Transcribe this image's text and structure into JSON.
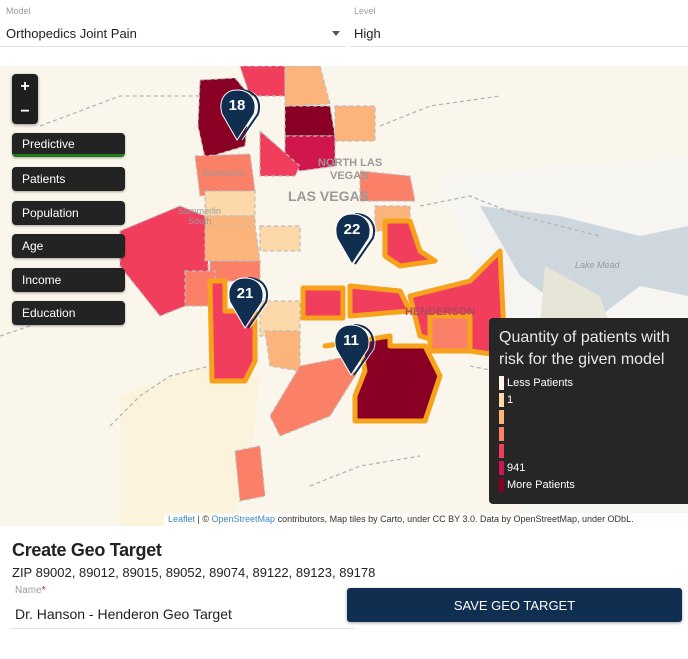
{
  "filters": {
    "model_label": "Model",
    "model_value": "Orthopedics Joint  Pain",
    "level_label": "Level",
    "level_value": "High"
  },
  "map": {
    "zoom_in": "+",
    "zoom_out": "−",
    "layers": [
      {
        "label": "Predictive",
        "active": true
      },
      {
        "label": "Patients",
        "active": false
      },
      {
        "label": "Population",
        "active": false
      },
      {
        "label": "Age",
        "active": false
      },
      {
        "label": "Income",
        "active": false
      },
      {
        "label": "Education",
        "active": false
      }
    ],
    "place_labels": [
      "NORTH LAS VEGAS",
      "LAS VEGAS",
      "Summerlin",
      "Summerlin South",
      "HENDERSON",
      "Lake Mead",
      "Spring Valley"
    ],
    "clusters": [
      {
        "count": "18"
      },
      {
        "count": "22"
      },
      {
        "count": "21"
      },
      {
        "count": "11"
      }
    ],
    "marker_color": "#0f2e50",
    "selected_outline_color": "#f7a21b",
    "legend": {
      "title": "Quantity of patients with risk for the given model",
      "items": [
        {
          "label": "Less Patients",
          "color": "#fff5e8"
        },
        {
          "label": "1",
          "color": "#fdd9a9"
        },
        {
          "label": "",
          "color": "#fdb47a"
        },
        {
          "label": "",
          "color": "#fb8068"
        },
        {
          "label": "",
          "color": "#f03e5c"
        },
        {
          "label": "941",
          "color": "#d0164a"
        },
        {
          "label": "More Patients",
          "color": "#8a0025"
        }
      ]
    },
    "attribution": {
      "leaflet": "Leaflet",
      "sep": " | © ",
      "osm": "OpenStreetMap",
      "rest": " contributors, Map tiles by Carto, under CC BY 3.0. Data by OpenStreetMap, under ODbL."
    }
  },
  "form": {
    "title": "Create Geo Target",
    "zips": "ZIP 89002, 89012, 89015, 89052, 89074, 89122, 89123, 89178",
    "name_label": "Name",
    "required_mark": "*",
    "name_value": "Dr. Hanson - Henderon Geo Target",
    "save_label": "SAVE GEO TARGET"
  }
}
